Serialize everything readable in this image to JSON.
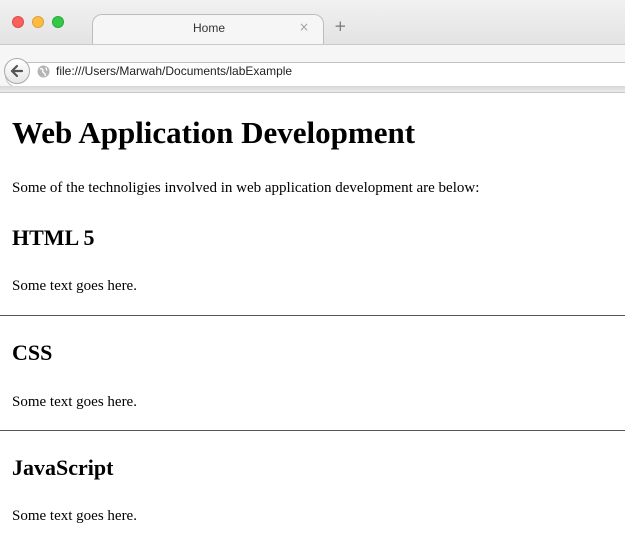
{
  "browser": {
    "tab": {
      "title": "Home",
      "close_glyph": "×"
    },
    "new_tab_glyph": "+",
    "address": "file:///Users/Marwah/Documents/labExample",
    "icons": [
      "back-arrow-icon",
      "globe-icon",
      "close-icon",
      "plus-icon"
    ]
  },
  "page": {
    "title": "Web Application Development",
    "intro": "Some of the technoligies involved in web application development are below:",
    "sections": [
      {
        "heading": "HTML 5",
        "text": "Some text goes here."
      },
      {
        "heading": "CSS",
        "text": "Some text goes here."
      },
      {
        "heading": "JavaScript",
        "text": "Some text goes here."
      }
    ]
  },
  "colors": {
    "close": "#fc605c",
    "minimize": "#fdbc40",
    "maximize": "#34c84a"
  }
}
